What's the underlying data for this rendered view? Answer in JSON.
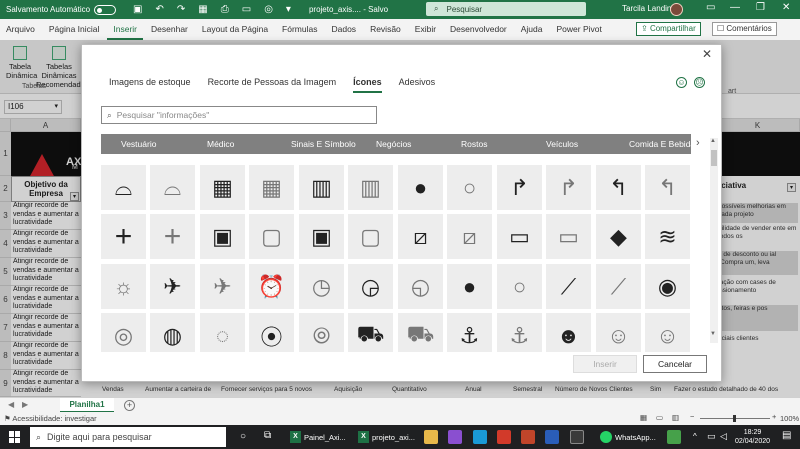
{
  "titlebar": {
    "autosave": "Salvamento Automático",
    "autosave_state": "",
    "file": "projeto_axis.... - Salvo",
    "search": "Pesquisar",
    "user": "Tarcila Landin"
  },
  "ribbon": {
    "tabs": [
      "Arquivo",
      "Página Inicial",
      "Inserir",
      "Desenhar",
      "Layout da Página",
      "Fórmulas",
      "Dados",
      "Revisão",
      "Exibir",
      "Desenvolvedor",
      "Ajuda",
      "Power Pivot"
    ],
    "active_tab": "Inserir",
    "share": "Compartilhar",
    "comments": "Comentários",
    "btn_table": "Tabela Dinâmica",
    "btn_recommended": "Tabelas Dinâmicas Recomendadas",
    "group_label": "Tabelas",
    "right_label_1": "art",
    "right_label_2": "nas"
  },
  "formula_bar": {
    "name_box": "I106"
  },
  "sheet": {
    "col_a": "A",
    "col_k": "K",
    "logo_text": "AX",
    "logo_sub": "M",
    "header_a": "Objetivo da Empresa",
    "header_k": "iciativa",
    "rows": [
      "1",
      "2",
      "3",
      "4",
      "5",
      "6",
      "7",
      "8",
      "9"
    ],
    "cell_a_text": "Atingir recorde de vendas e aumentar a lucratividade",
    "k_cells": [
      "possíveis melhorias em cada projeto",
      "bilidade de vender ente em todos os",
      "a de desconto ou ial (Compra um, leva",
      "tação com cases de issionamento",
      "ntos, feiras e pos",
      "nciais clientes"
    ],
    "bottom": [
      "Vendas",
      "Aumentar a carteira de",
      "Fornecer serviços para 5 novos",
      "Aquisição",
      "Quantitativo",
      "Anual",
      "Semestral",
      "Número de Novos Clientes",
      "Sim",
      "Fazer o estudo detalhado de 40 dos"
    ],
    "sheet_tab": "Planilha1",
    "status": "Acessibilidade: investigar",
    "zoom": "100%"
  },
  "dialog": {
    "tabs": [
      "Imagens de estoque",
      "Recorte de Pessoas da Imagem",
      "Ícones",
      "Adesivos"
    ],
    "active_tab": "Ícones",
    "search_placeholder": "Pesquisar \"informações\"",
    "categories": [
      "Vestuário",
      "Médico",
      "Sinais E Símbolos",
      "Negócios",
      "Rostos",
      "Veículos",
      "Comida E Bebida"
    ],
    "insert": "Inserir",
    "cancel": "Cancelar",
    "icons": [
      [
        "glasses-3d",
        "glasses-3d-outline",
        "abacus",
        "abacus-outline",
        "abacus",
        "abacus-outline",
        "acorn",
        "acorn-outline",
        "turn-right-arrow",
        "turn-right-arrow-outline",
        "turn-left-arrow",
        "turn-left-arrow-outline"
      ],
      [
        "plus",
        "plus-outline",
        "address-book",
        "address-book-outline",
        "address-book",
        "address-book-outline",
        "bandage",
        "bandage-outline",
        "billboard",
        "billboard-outline",
        "africa",
        "field"
      ],
      [
        "field-sun",
        "airplane",
        "airplane-outline",
        "alarm-clock",
        "alarm-clock-outline",
        "alarm-ringing",
        "alarm-ringing-outline",
        "alien",
        "alien-outline",
        "yarn-needle",
        "yarn-needle-outline",
        "yarn-ball"
      ],
      [
        "yarn-ball-outline",
        "measuring-tape",
        "measuring-tape-outline",
        "button",
        "button-outline",
        "ambulance",
        "ambulance-outline",
        "anchor",
        "anchor-outline",
        "angel-face",
        "angel-face-outline",
        "angel-face-outline"
      ]
    ]
  },
  "taskbar": {
    "search": "Digite aqui para pesquisar",
    "app1": "Painel_Axi...",
    "app2": "projeto_axi...",
    "app3": "WhatsApp...",
    "time": "18:29",
    "date": "02/04/2020"
  }
}
